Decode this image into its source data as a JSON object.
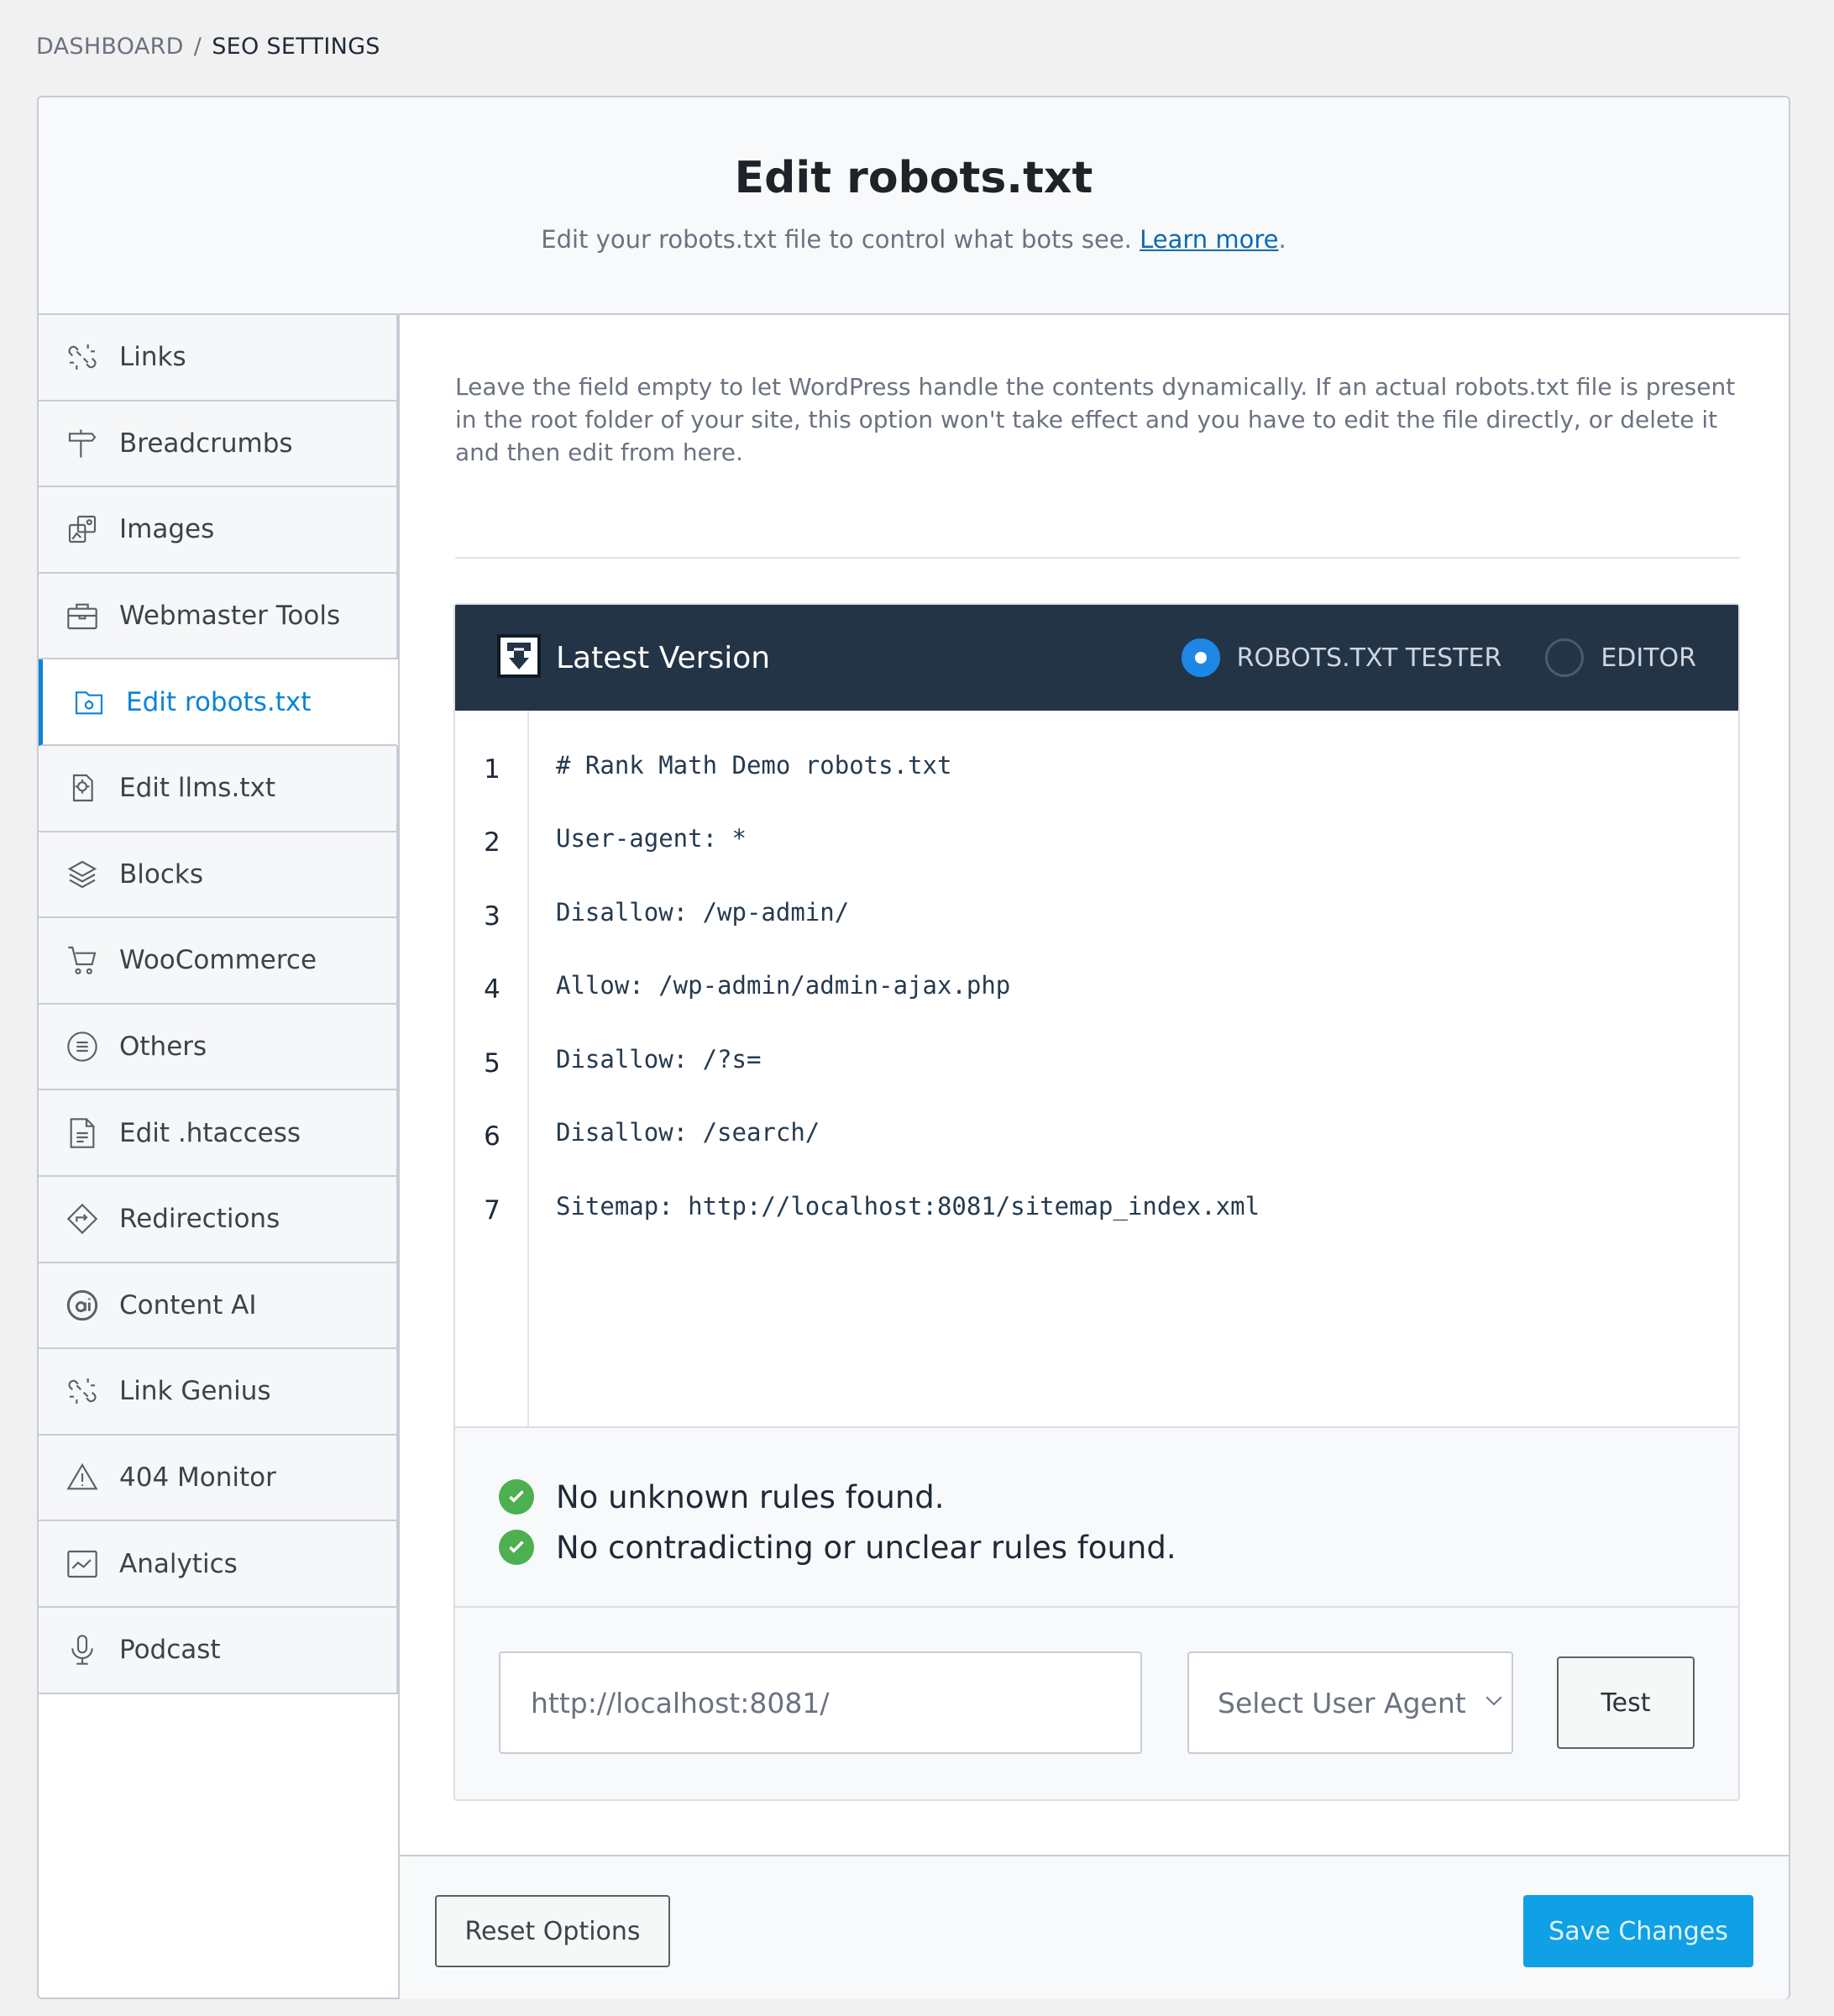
{
  "breadcrumb": {
    "root": "DASHBOARD",
    "separator": "/",
    "current": "SEO SETTINGS"
  },
  "header": {
    "title": "Edit robots.txt",
    "subtitle": "Edit your robots.txt file to control what bots see.",
    "learn_more": "Learn more",
    "period": "."
  },
  "sidebar": {
    "items": [
      {
        "label": "Links",
        "icon": "links-icon"
      },
      {
        "label": "Breadcrumbs",
        "icon": "signpost-icon"
      },
      {
        "label": "Images",
        "icon": "images-icon"
      },
      {
        "label": "Webmaster Tools",
        "icon": "toolbox-icon"
      },
      {
        "label": "Edit robots.txt",
        "icon": "robots-file-icon",
        "active": true
      },
      {
        "label": "Edit llms.txt",
        "icon": "llms-icon"
      },
      {
        "label": "Blocks",
        "icon": "blocks-icon"
      },
      {
        "label": "WooCommerce",
        "icon": "cart-icon"
      },
      {
        "label": "Others",
        "icon": "list-circle-icon"
      },
      {
        "label": "Edit .htaccess",
        "icon": "document-icon"
      },
      {
        "label": "Redirections",
        "icon": "redirect-icon"
      },
      {
        "label": "Content AI",
        "icon": "content-ai-icon"
      },
      {
        "label": "Link Genius",
        "icon": "link-genius-icon"
      },
      {
        "label": "404 Monitor",
        "icon": "warning-icon"
      },
      {
        "label": "Analytics",
        "icon": "analytics-icon"
      },
      {
        "label": "Podcast",
        "icon": "microphone-icon"
      }
    ]
  },
  "content": {
    "description": "Leave the field empty to let WordPress handle the contents dynamically. If an actual robots.txt file is present in the root folder of your site, this option won't take effect and you have to edit the file directly, or delete it and then edit from here."
  },
  "editor": {
    "title": "Latest Version",
    "mode_tester": "ROBOTS.TXT TESTER",
    "mode_editor": "EDITOR",
    "selected_mode": "tester",
    "lines": [
      {
        "num": "1",
        "text": "# Rank Math Demo robots.txt"
      },
      {
        "num": "2",
        "text": "User-agent: *"
      },
      {
        "num": "3",
        "text": "Disallow: /wp-admin/"
      },
      {
        "num": "4",
        "text": "Allow: /wp-admin/admin-ajax.php"
      },
      {
        "num": "5",
        "text": "Disallow: /?s="
      },
      {
        "num": "6",
        "text": "Disallow: /search/"
      },
      {
        "num": "7",
        "text": "Sitemap: http://localhost:8081/sitemap_index.xml"
      }
    ]
  },
  "checks": {
    "unknown": "No unknown rules found.",
    "contradicting": "No contradicting or unclear rules found."
  },
  "tester": {
    "url_value": "http://localhost:8081/",
    "user_agent_placeholder": "Select User Agent",
    "test_label": "Test"
  },
  "footer": {
    "reset_label": "Reset Options",
    "save_label": "Save Changes"
  },
  "colors": {
    "accent": "#0b84d6",
    "save_button": "#10a0e6",
    "editor_bar": "#243447",
    "check_ok": "#4caf50"
  }
}
